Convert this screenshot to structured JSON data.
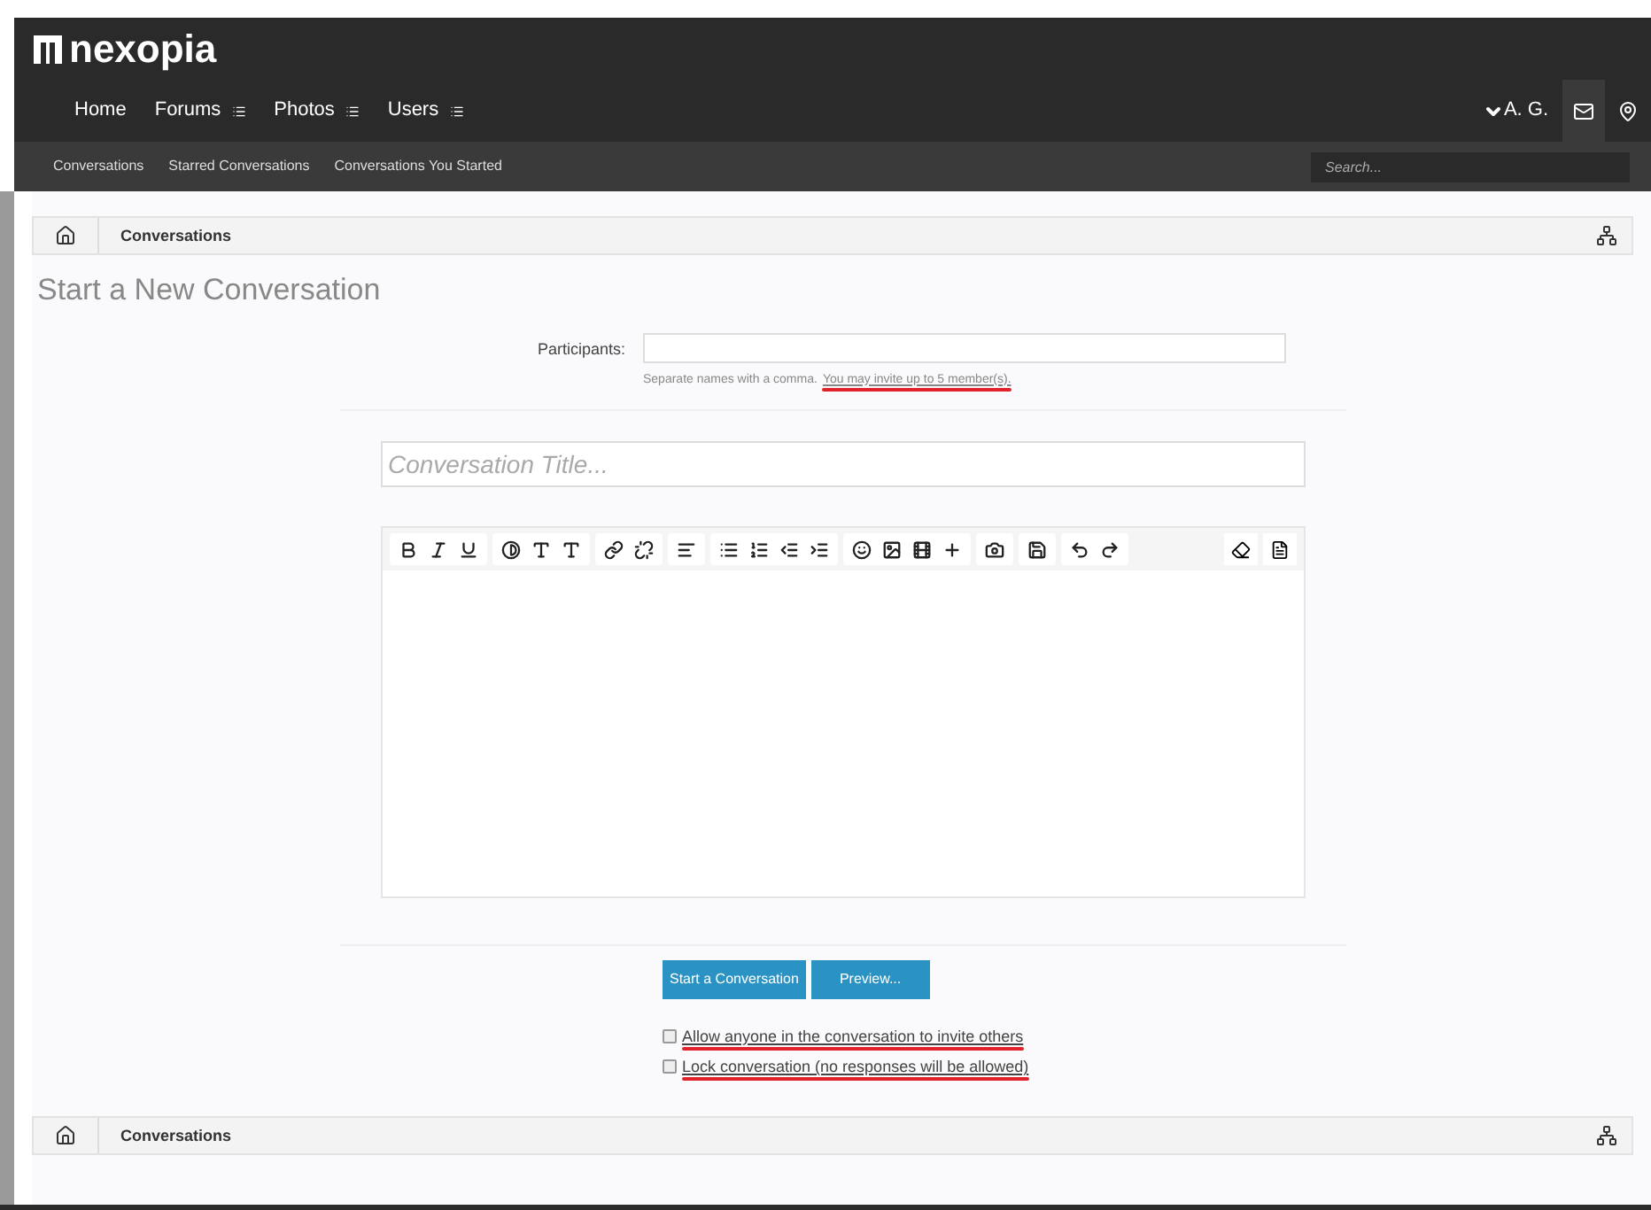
{
  "site": {
    "logo": "nexopia"
  },
  "nav": {
    "items": [
      {
        "label": "Home",
        "menu": false
      },
      {
        "label": "Forums",
        "menu": true
      },
      {
        "label": "Photos",
        "menu": true
      },
      {
        "label": "Users",
        "menu": true
      }
    ],
    "user": "A. G."
  },
  "subnav": {
    "items": [
      "Conversations",
      "Starred Conversations",
      "Conversations You Started"
    ],
    "search": {
      "placeholder": "Search..."
    }
  },
  "breadcrumb_top": {
    "items": [
      "Conversations"
    ]
  },
  "page_title": "Start a New Conversation",
  "form": {
    "participants": {
      "label": "Participants:",
      "hint": "Separate names with a comma.",
      "limit": "You may invite up to 5 member(s)."
    },
    "title_field": {
      "placeholder": "Conversation Title..."
    },
    "buttons": [
      "Start a Conversation",
      "Preview..."
    ],
    "options": [
      {
        "label": "Allow anyone in the conversation to invite others",
        "checked": false
      },
      {
        "label": "Lock conversation (no responses will be allowed)",
        "checked": false
      }
    ]
  },
  "breadcrumb_bottom": {
    "items": [
      "Conversations"
    ]
  }
}
